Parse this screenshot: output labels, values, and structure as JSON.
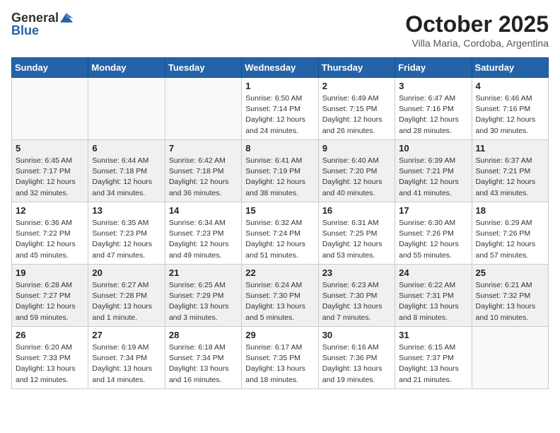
{
  "header": {
    "logo_general": "General",
    "logo_blue": "Blue",
    "month_title": "October 2025",
    "subtitle": "Villa Maria, Cordoba, Argentina"
  },
  "days_of_week": [
    "Sunday",
    "Monday",
    "Tuesday",
    "Wednesday",
    "Thursday",
    "Friday",
    "Saturday"
  ],
  "weeks": [
    [
      {
        "day": "",
        "info": ""
      },
      {
        "day": "",
        "info": ""
      },
      {
        "day": "",
        "info": ""
      },
      {
        "day": "1",
        "info": "Sunrise: 6:50 AM\nSunset: 7:14 PM\nDaylight: 12 hours\nand 24 minutes."
      },
      {
        "day": "2",
        "info": "Sunrise: 6:49 AM\nSunset: 7:15 PM\nDaylight: 12 hours\nand 26 minutes."
      },
      {
        "day": "3",
        "info": "Sunrise: 6:47 AM\nSunset: 7:16 PM\nDaylight: 12 hours\nand 28 minutes."
      },
      {
        "day": "4",
        "info": "Sunrise: 6:46 AM\nSunset: 7:16 PM\nDaylight: 12 hours\nand 30 minutes."
      }
    ],
    [
      {
        "day": "5",
        "info": "Sunrise: 6:45 AM\nSunset: 7:17 PM\nDaylight: 12 hours\nand 32 minutes."
      },
      {
        "day": "6",
        "info": "Sunrise: 6:44 AM\nSunset: 7:18 PM\nDaylight: 12 hours\nand 34 minutes."
      },
      {
        "day": "7",
        "info": "Sunrise: 6:42 AM\nSunset: 7:18 PM\nDaylight: 12 hours\nand 36 minutes."
      },
      {
        "day": "8",
        "info": "Sunrise: 6:41 AM\nSunset: 7:19 PM\nDaylight: 12 hours\nand 38 minutes."
      },
      {
        "day": "9",
        "info": "Sunrise: 6:40 AM\nSunset: 7:20 PM\nDaylight: 12 hours\nand 40 minutes."
      },
      {
        "day": "10",
        "info": "Sunrise: 6:39 AM\nSunset: 7:21 PM\nDaylight: 12 hours\nand 41 minutes."
      },
      {
        "day": "11",
        "info": "Sunrise: 6:37 AM\nSunset: 7:21 PM\nDaylight: 12 hours\nand 43 minutes."
      }
    ],
    [
      {
        "day": "12",
        "info": "Sunrise: 6:36 AM\nSunset: 7:22 PM\nDaylight: 12 hours\nand 45 minutes."
      },
      {
        "day": "13",
        "info": "Sunrise: 6:35 AM\nSunset: 7:23 PM\nDaylight: 12 hours\nand 47 minutes."
      },
      {
        "day": "14",
        "info": "Sunrise: 6:34 AM\nSunset: 7:23 PM\nDaylight: 12 hours\nand 49 minutes."
      },
      {
        "day": "15",
        "info": "Sunrise: 6:32 AM\nSunset: 7:24 PM\nDaylight: 12 hours\nand 51 minutes."
      },
      {
        "day": "16",
        "info": "Sunrise: 6:31 AM\nSunset: 7:25 PM\nDaylight: 12 hours\nand 53 minutes."
      },
      {
        "day": "17",
        "info": "Sunrise: 6:30 AM\nSunset: 7:26 PM\nDaylight: 12 hours\nand 55 minutes."
      },
      {
        "day": "18",
        "info": "Sunrise: 6:29 AM\nSunset: 7:26 PM\nDaylight: 12 hours\nand 57 minutes."
      }
    ],
    [
      {
        "day": "19",
        "info": "Sunrise: 6:28 AM\nSunset: 7:27 PM\nDaylight: 12 hours\nand 59 minutes."
      },
      {
        "day": "20",
        "info": "Sunrise: 6:27 AM\nSunset: 7:28 PM\nDaylight: 13 hours\nand 1 minute."
      },
      {
        "day": "21",
        "info": "Sunrise: 6:25 AM\nSunset: 7:29 PM\nDaylight: 13 hours\nand 3 minutes."
      },
      {
        "day": "22",
        "info": "Sunrise: 6:24 AM\nSunset: 7:30 PM\nDaylight: 13 hours\nand 5 minutes."
      },
      {
        "day": "23",
        "info": "Sunrise: 6:23 AM\nSunset: 7:30 PM\nDaylight: 13 hours\nand 7 minutes."
      },
      {
        "day": "24",
        "info": "Sunrise: 6:22 AM\nSunset: 7:31 PM\nDaylight: 13 hours\nand 8 minutes."
      },
      {
        "day": "25",
        "info": "Sunrise: 6:21 AM\nSunset: 7:32 PM\nDaylight: 13 hours\nand 10 minutes."
      }
    ],
    [
      {
        "day": "26",
        "info": "Sunrise: 6:20 AM\nSunset: 7:33 PM\nDaylight: 13 hours\nand 12 minutes."
      },
      {
        "day": "27",
        "info": "Sunrise: 6:19 AM\nSunset: 7:34 PM\nDaylight: 13 hours\nand 14 minutes."
      },
      {
        "day": "28",
        "info": "Sunrise: 6:18 AM\nSunset: 7:34 PM\nDaylight: 13 hours\nand 16 minutes."
      },
      {
        "day": "29",
        "info": "Sunrise: 6:17 AM\nSunset: 7:35 PM\nDaylight: 13 hours\nand 18 minutes."
      },
      {
        "day": "30",
        "info": "Sunrise: 6:16 AM\nSunset: 7:36 PM\nDaylight: 13 hours\nand 19 minutes."
      },
      {
        "day": "31",
        "info": "Sunrise: 6:15 AM\nSunset: 7:37 PM\nDaylight: 13 hours\nand 21 minutes."
      },
      {
        "day": "",
        "info": ""
      }
    ]
  ]
}
